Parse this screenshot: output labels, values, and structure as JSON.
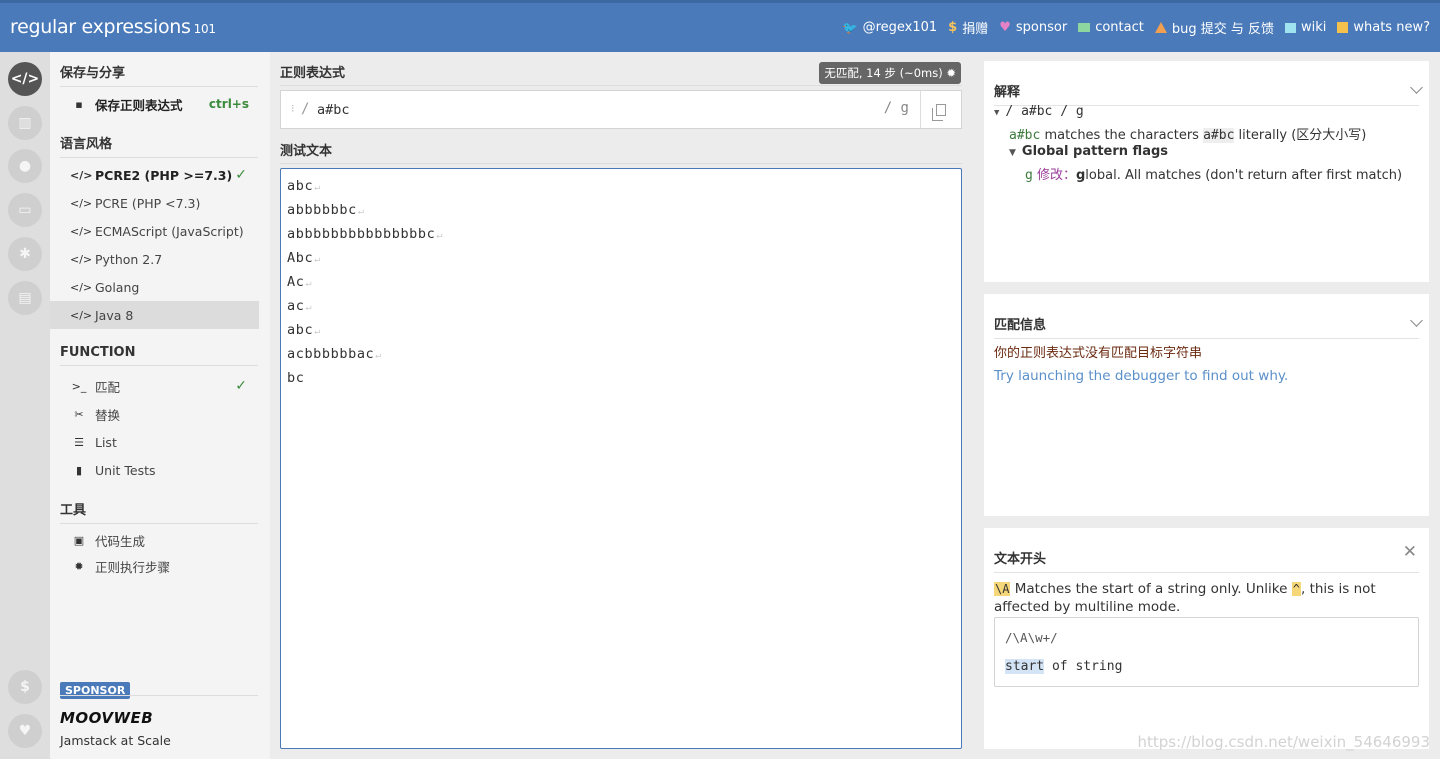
{
  "app": {
    "logo_main": "regular expressions",
    "logo_version": "101"
  },
  "topnav": [
    {
      "label": "@regex101",
      "icon": "twitter-icon"
    },
    {
      "label": "捐赠",
      "icon": "dollar-icon"
    },
    {
      "label": "sponsor",
      "icon": "heart-icon"
    },
    {
      "label": "contact",
      "icon": "mail-icon"
    },
    {
      "label": "bug 提交 与 反馈",
      "icon": "warning-icon"
    },
    {
      "label": "wiki",
      "icon": "wiki-icon"
    },
    {
      "label": "whats new?",
      "icon": "new-icon"
    }
  ],
  "sidebar": {
    "save_section": "保存与分享",
    "save_item": "保存正则表达式",
    "save_shortcut": "ctrl+s",
    "flavor_section": "语言风格",
    "flavors": [
      "PCRE2 (PHP >=7.3)",
      "PCRE (PHP <7.3)",
      "ECMAScript (JavaScript)",
      "Python 2.7",
      "Golang",
      "Java 8"
    ],
    "function_section": "FUNCTION",
    "functions": [
      "匹配",
      "替换",
      "List",
      "Unit Tests"
    ],
    "tools_section": "工具",
    "tools": [
      "代码生成",
      "正则执行步骤"
    ],
    "sponsor_badge": "SPONSOR",
    "sponsor_name": "MOOVWEB",
    "sponsor_tagline": "Jamstack at Scale"
  },
  "editor": {
    "regex_label": "正则表达式",
    "status": "无匹配, 14 步 (~0ms)",
    "delimiter": "/",
    "regex": "a#bc",
    "flags": "/ g",
    "test_label": "测试文本",
    "test_lines": [
      "abc",
      "abbbbbbc",
      "abbbbbbbbbbbbbbbc",
      "Abc",
      "Ac",
      "ac",
      "abc",
      "acbbbbbbac",
      "bc"
    ]
  },
  "explanation": {
    "title": "解释",
    "regex_line": "/ a#bc / g",
    "line1_token": "a#bc",
    "line1_text_a": " matches the characters ",
    "line1_literal": "a#bc",
    "line1_text_b": " literally (区分大小写)",
    "flags_heading": "Global pattern flags",
    "flag_letter": "g",
    "flag_modifier": "修改：",
    "flag_bold": "g",
    "flag_desc": "lobal. All matches (don't return after first match)"
  },
  "match_info": {
    "title": "匹配信息",
    "message": "你的正则表达式没有匹配目标字符串",
    "link": "Try launching the debugger to find out why."
  },
  "quick_ref": {
    "title": "文本开头",
    "token": "\\A",
    "text_a": " Matches the start of a string only. Unlike ",
    "caret": "^",
    "text_b": ", this is not affected by multiline mode.",
    "example_regex": "/\\A\\w+/",
    "example_match": "start",
    "example_rest": " of string"
  },
  "watermark": "https://blog.csdn.net/weixin_54646993"
}
